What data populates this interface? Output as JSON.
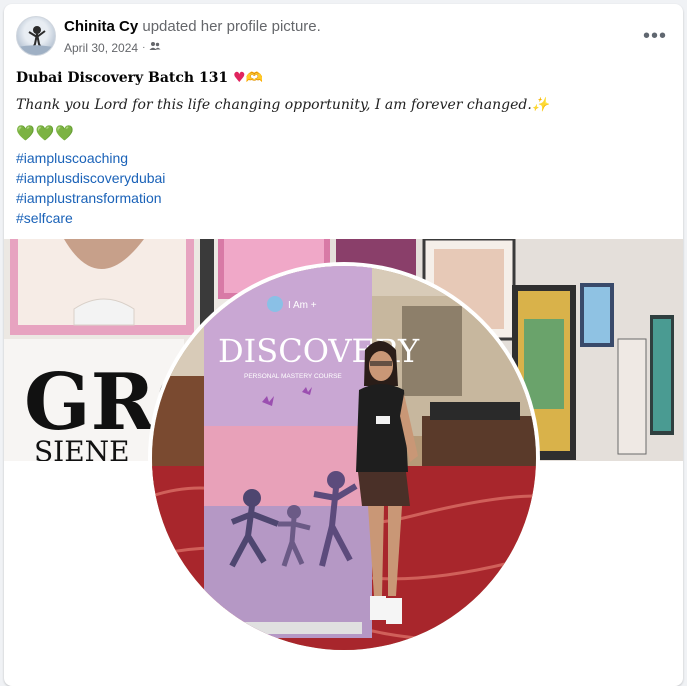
{
  "post": {
    "author": "Chinita Cy",
    "action": "updated her profile picture.",
    "date": "April 30, 2024",
    "audience_icon": "friends-icon",
    "more_icon": "more-options-icon"
  },
  "content": {
    "title": "Dubai Discovery Batch 131",
    "title_emojis": [
      "red-heart",
      "heart-hands"
    ],
    "quote": "Thank you Lord for this life changing opportunity, I am forever changed.",
    "hearts": "💚💚💚",
    "hashtags": [
      "#iampluscoaching",
      "#iamplusdiscoverydubai",
      "#iamplustransformation",
      "#selfcare"
    ]
  },
  "cover_photo": {
    "wall_text": "GRO",
    "wall_subtext": "SIENE"
  },
  "profile_photo": {
    "banner_brand": "I Am +",
    "banner_title": "DISCOVERY",
    "banner_subtitle": "PERSONAL MASTERY COURSE"
  },
  "colors": {
    "link": "#1a62b8",
    "secondary_text": "#65676b",
    "card_bg": "#ffffff",
    "page_bg": "#f0f2f5"
  }
}
